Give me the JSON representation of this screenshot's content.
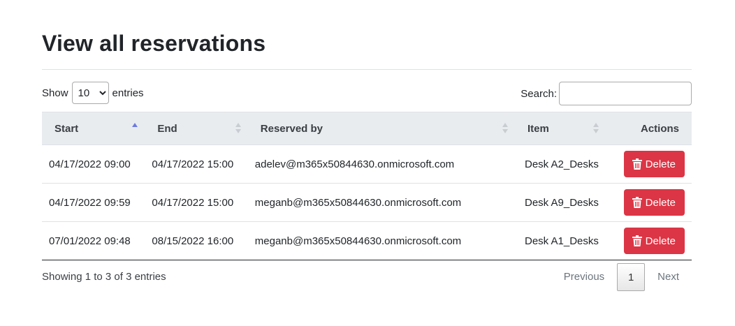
{
  "page": {
    "title": "View all reservations"
  },
  "controls": {
    "show_label": "Show",
    "entries_label": "entries",
    "page_length": "10",
    "search_label": "Search:",
    "search_value": ""
  },
  "table": {
    "columns": [
      "Start",
      "End",
      "Reserved by",
      "Item",
      "Actions"
    ],
    "sorted_column": "Start",
    "sort_direction": "ascending",
    "rows": [
      {
        "start": "04/17/2022 09:00",
        "end": "04/17/2022 15:00",
        "reserved_by": "adelev@m365x50844630.onmicrosoft.com",
        "item": "Desk A2_Desks",
        "action": "Delete"
      },
      {
        "start": "04/17/2022 09:59",
        "end": "04/17/2022 15:00",
        "reserved_by": "meganb@m365x50844630.onmicrosoft.com",
        "item": "Desk A9_Desks",
        "action": "Delete"
      },
      {
        "start": "07/01/2022 09:48",
        "end": "08/15/2022 16:00",
        "reserved_by": "meganb@m365x50844630.onmicrosoft.com",
        "item": "Desk A1_Desks",
        "action": "Delete"
      }
    ]
  },
  "footer": {
    "info": "Showing 1 to 3 of 3 entries",
    "previous": "Previous",
    "current_page": "1",
    "next": "Next"
  },
  "colors": {
    "delete_button": "#dc3545",
    "header_bg": "#e9ecef",
    "sort_active": "#6c7ae0"
  },
  "icons": {
    "delete": "trash-icon",
    "sort": "sort-arrows-icon"
  }
}
